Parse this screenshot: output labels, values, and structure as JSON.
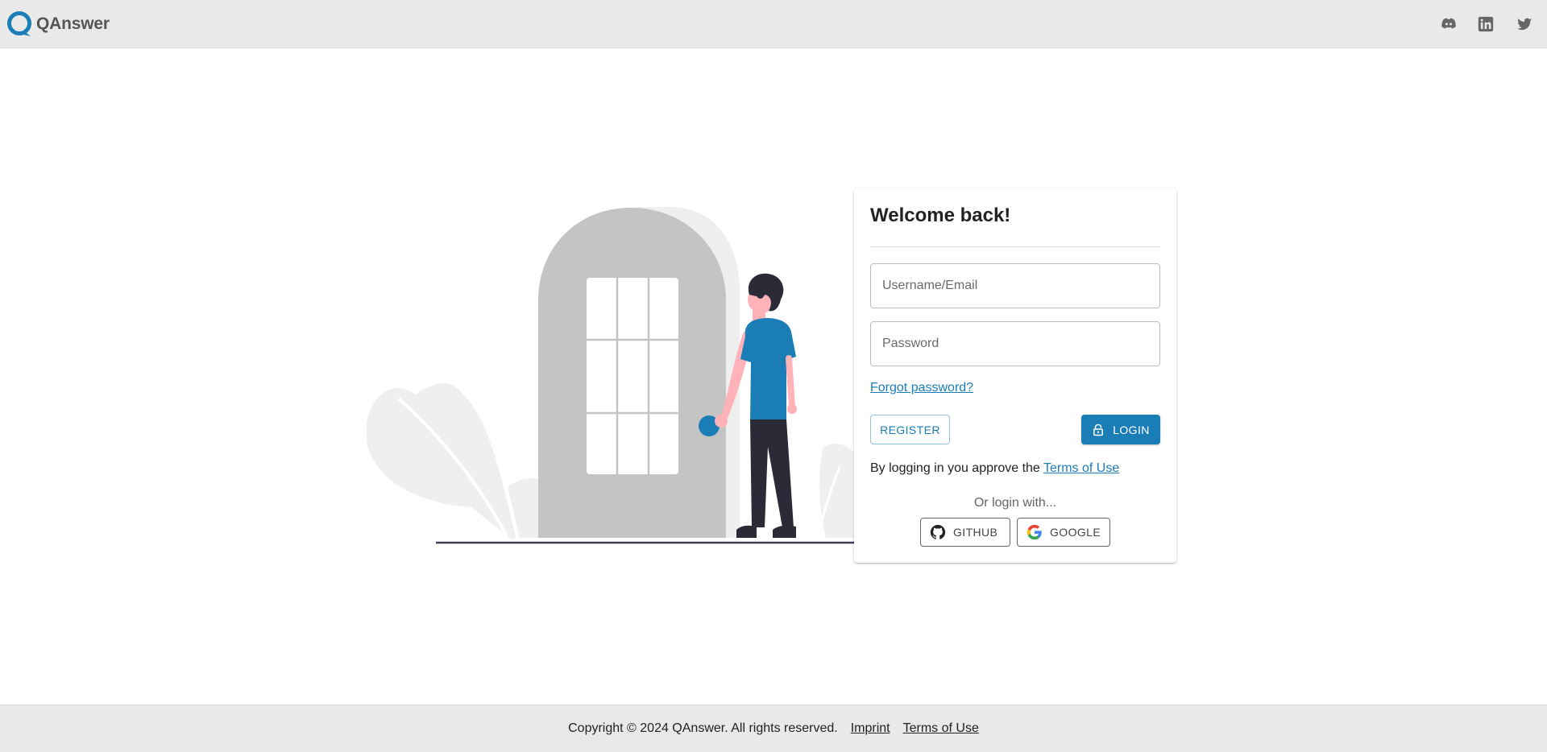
{
  "header": {
    "brand_name": "QAnswer",
    "social_links": [
      "discord-icon",
      "linkedin-icon",
      "twitter-icon"
    ]
  },
  "login": {
    "title": "Welcome back!",
    "username_placeholder": "Username/Email",
    "password_placeholder": "Password",
    "forgot_password": "Forgot password?",
    "register_label": "REGISTER",
    "login_label": "LOGIN",
    "approve_text": "By logging in you approve the",
    "terms_label": "Terms of Use",
    "or_login_with": "Or login with...",
    "github_label": "GITHUB",
    "google_label": "GOOGLE"
  },
  "footer": {
    "copyright": "Copyright © 2024 QAnswer. All rights reserved.",
    "imprint": "Imprint",
    "terms": "Terms of Use"
  },
  "colors": {
    "accent": "#1a7db6",
    "header_bg": "#e9e9e9",
    "illustration_gray": "#c4c4c4",
    "illustration_dark": "#2b2a37"
  }
}
